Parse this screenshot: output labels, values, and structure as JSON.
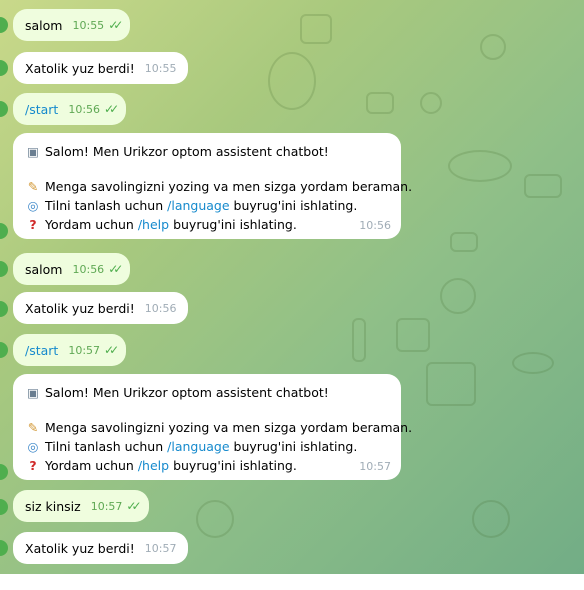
{
  "messages": [
    {
      "text": "salom",
      "time": "10:55",
      "outgoing": true
    },
    {
      "text": "Xatolik yuz berdi!",
      "time": "10:55",
      "outgoing": false
    },
    {
      "text": "/start",
      "time": "10:56",
      "outgoing": true
    },
    {
      "time": "10:56",
      "outgoing": false,
      "greeting": "Salom! Men Urikzor optom assistent chatbot!",
      "help_line": "Menga savolingizni yozing va men sizga yordam beraman.",
      "lang_prefix": "Tilni tanlash uchun",
      "lang_cmd": "/language",
      "lang_suffix": "buyrug'ini ishlating.",
      "help_prefix": "Yordam uchun",
      "help_cmd": "/help",
      "help_suffix": "buyrug'ini ishlating."
    },
    {
      "text": "salom",
      "time": "10:56",
      "outgoing": true
    },
    {
      "text": "Xatolik yuz berdi!",
      "time": "10:56",
      "outgoing": false
    },
    {
      "text": "/start",
      "time": "10:57",
      "outgoing": true
    },
    {
      "time": "10:57",
      "outgoing": false,
      "greeting": "Salom! Men Urikzor optom assistent chatbot!",
      "help_line": "Menga savolingizni yozing va men sizga yordam beraman.",
      "lang_prefix": "Tilni tanlash uchun",
      "lang_cmd": "/language",
      "lang_suffix": "buyrug'ini ishlating.",
      "help_prefix": "Yordam uchun",
      "help_cmd": "/help",
      "help_suffix": "buyrug'ini ishlating."
    },
    {
      "text": "siz kinsiz",
      "time": "10:57",
      "outgoing": true
    },
    {
      "text": "Xatolik yuz berdi!",
      "time": "10:57",
      "outgoing": false
    }
  ],
  "icons": {
    "read_receipt": "double-check-icon",
    "robot": "robot-emoji-icon",
    "memo": "memo-emoji-icon",
    "globe": "globe-emoji-icon",
    "question": "question-emoji-icon"
  },
  "colors": {
    "outgoing_bubble": "#effdde",
    "incoming_bubble": "#ffffff",
    "link": "#168acd",
    "check": "#4fae4e"
  }
}
